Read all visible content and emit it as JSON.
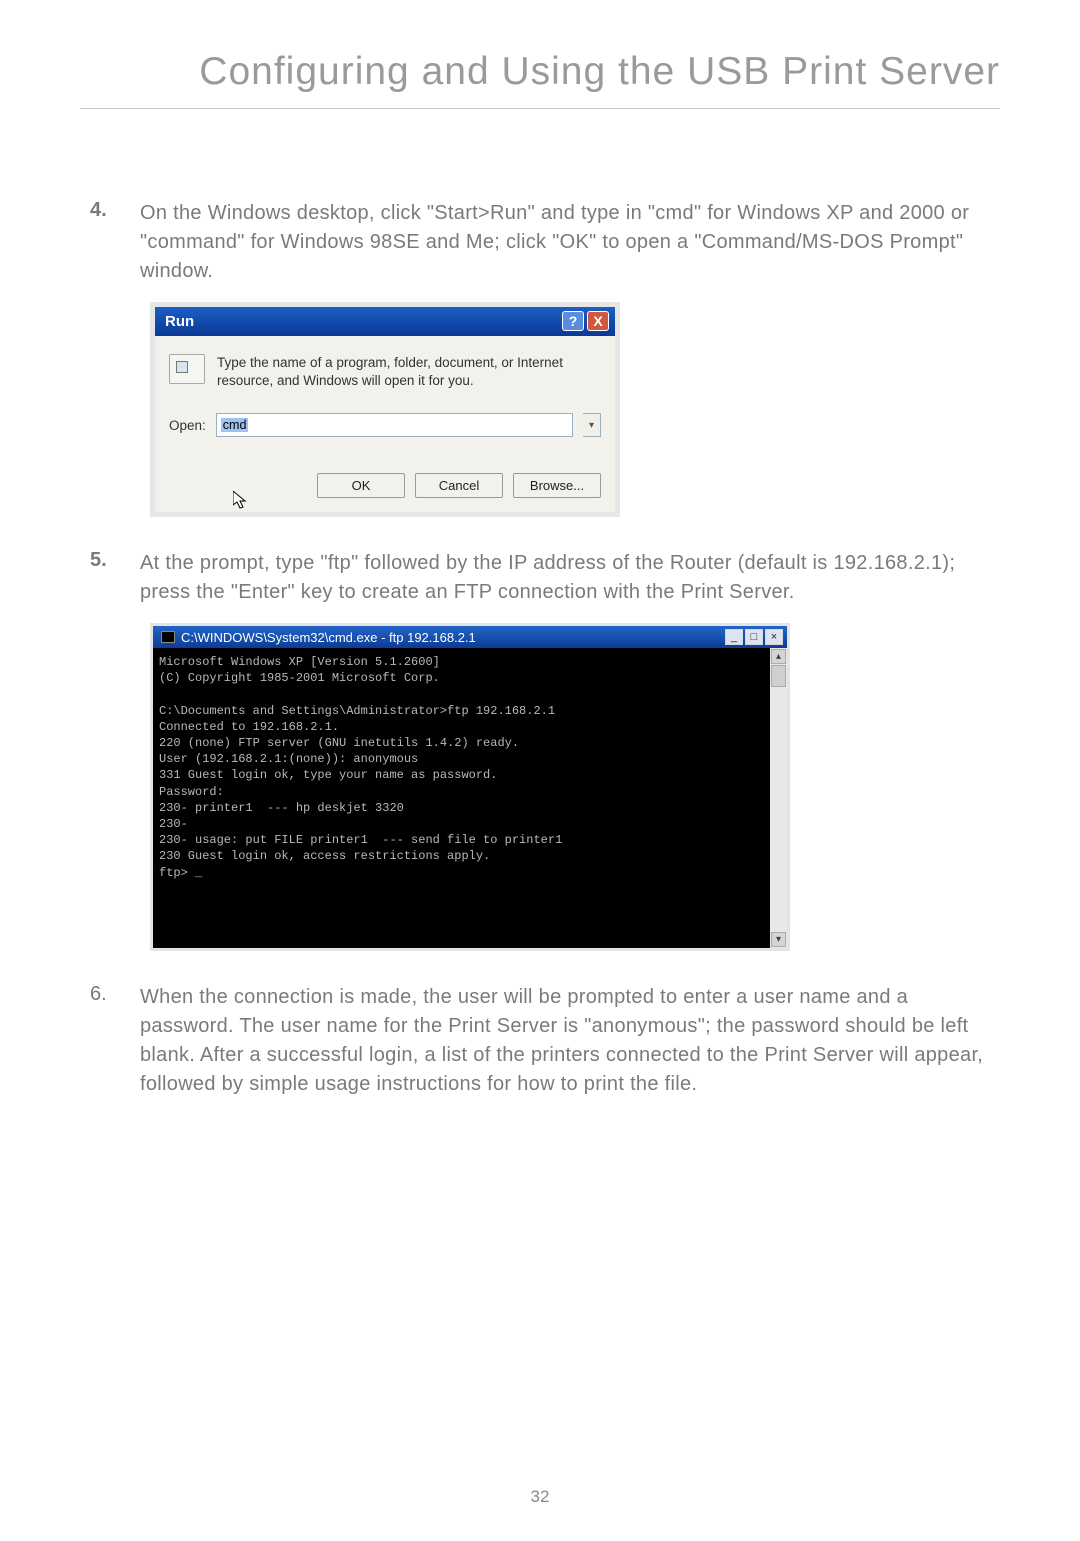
{
  "page_title": "Configuring and Using the USB Print Server",
  "page_number": "32",
  "steps": {
    "s4": {
      "num": "4.",
      "text": "On the Windows desktop, click \"Start>Run\" and type in \"cmd\" for Windows XP and 2000 or \"command\" for Windows 98SE and Me; click \"OK\" to open a \"Command/MS-DOS Prompt\" window."
    },
    "s5": {
      "num": "5.",
      "text": "At the prompt, type \"ftp\" followed by the IP address of the Router (default is 192.168.2.1); press the \"Enter\" key to create an FTP connection with the Print Server."
    },
    "s6": {
      "num": "6.",
      "text": "When the connection is made, the user will be prompted to enter a user name and a password. The user name for the Print Server is \"anonymous\"; the password should be left blank. After a successful login, a list of the printers connected to the Print Server will appear, followed by simple usage instructions for how to print the file."
    }
  },
  "run_dialog": {
    "title": "Run",
    "help": "?",
    "close": "X",
    "description": "Type the name of a program, folder, document, or Internet resource, and Windows will open it for you.",
    "open_label": "Open:",
    "input_value": "cmd",
    "dropdown_icon": "▾",
    "ok": "OK",
    "cancel": "Cancel",
    "browse": "Browse..."
  },
  "cmd_window": {
    "title": "C:\\WINDOWS\\System32\\cmd.exe - ftp 192.168.2.1",
    "min": "_",
    "max": "□",
    "close": "×",
    "scroll_up": "▴",
    "scroll_down": "▾",
    "body": "Microsoft Windows XP [Version 5.1.2600]\n(C) Copyright 1985-2001 Microsoft Corp.\n\nC:\\Documents and Settings\\Administrator>ftp 192.168.2.1\nConnected to 192.168.2.1.\n220 (none) FTP server (GNU inetutils 1.4.2) ready.\nUser (192.168.2.1:(none)): anonymous\n331 Guest login ok, type your name as password.\nPassword:\n230- printer1  --- hp deskjet 3320\n230-\n230- usage: put FILE printer1  --- send file to printer1\n230 Guest login ok, access restrictions apply.\nftp> _"
  }
}
